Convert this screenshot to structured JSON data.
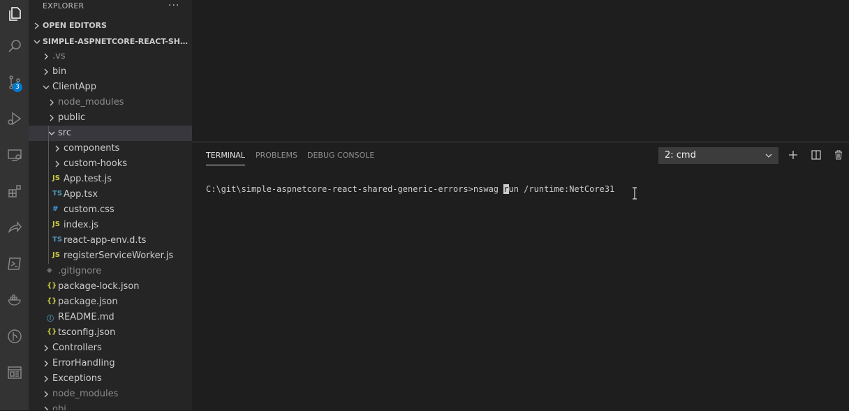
{
  "sidebar": {
    "title": "EXPLORER",
    "more_label": "···",
    "open_editors_label": "OPEN EDITORS",
    "project_label": "SIMPLE-ASPNETCORE-REACT-SHARED-...",
    "tree": [
      {
        "label": ".vs",
        "icon": "chevron-right-icon"
      },
      {
        "label": "bin",
        "icon": "chevron-right-icon"
      },
      {
        "label": "ClientApp",
        "icon": "chevron-down-icon"
      },
      {
        "label": "node_modules",
        "icon": "chevron-right-icon"
      },
      {
        "label": "public",
        "icon": "chevron-right-icon"
      },
      {
        "label": "src",
        "icon": "chevron-down-icon"
      },
      {
        "label": "components",
        "icon": "chevron-right-icon"
      },
      {
        "label": "custom-hooks",
        "icon": "chevron-right-icon"
      },
      {
        "label": "App.test.js",
        "icon": "js-file-icon",
        "badge": "JS"
      },
      {
        "label": "App.tsx",
        "icon": "ts-file-icon",
        "badge": "TS"
      },
      {
        "label": "custom.css",
        "icon": "css-file-icon",
        "badge": "#"
      },
      {
        "label": "index.js",
        "icon": "js-file-icon",
        "badge": "JS"
      },
      {
        "label": "react-app-env.d.ts",
        "icon": "ts-file-icon",
        "badge": "TS"
      },
      {
        "label": "registerServiceWorker.js",
        "icon": "js-file-icon",
        "badge": "JS"
      },
      {
        "label": ".gitignore",
        "icon": "git-file-icon",
        "badge": "◆"
      },
      {
        "label": "package-lock.json",
        "icon": "json-file-icon",
        "badge": "{}"
      },
      {
        "label": "package.json",
        "icon": "json-file-icon",
        "badge": "{}"
      },
      {
        "label": "README.md",
        "icon": "info-file-icon",
        "badge": "ⓘ"
      },
      {
        "label": "tsconfig.json",
        "icon": "json-file-icon",
        "badge": "{}"
      },
      {
        "label": "Controllers",
        "icon": "chevron-right-icon"
      },
      {
        "label": "ErrorHandling",
        "icon": "chevron-right-icon"
      },
      {
        "label": "Exceptions",
        "icon": "chevron-right-icon"
      },
      {
        "label": "node_modules",
        "icon": "chevron-right-icon"
      },
      {
        "label": "obj",
        "icon": "chevron-right-icon"
      }
    ]
  },
  "activity_bar": {
    "source_control_badge": "3"
  },
  "panel": {
    "tabs": [
      {
        "label": "TERMINAL",
        "active": true
      },
      {
        "label": "PROBLEMS",
        "active": false
      },
      {
        "label": "DEBUG CONSOLE",
        "active": false
      }
    ],
    "terminal_select_value": "2: cmd",
    "terminal": {
      "prompt_before_cursor": "C:\\git\\simple-aspnetcore-react-shared-generic-errors>nswag ",
      "cursor_char": "r",
      "after_cursor": "un /runtime:NetCore31"
    }
  },
  "colors": {
    "activity_bar_bg": "#333333",
    "sidebar_bg": "#252526",
    "editor_bg": "#1e1e1e",
    "badge_bg": "#007acc",
    "js_icon": "#cbcb41",
    "ts_icon": "#519aba",
    "css_icon": "#42a5f5",
    "json_icon": "#cbcb41"
  }
}
